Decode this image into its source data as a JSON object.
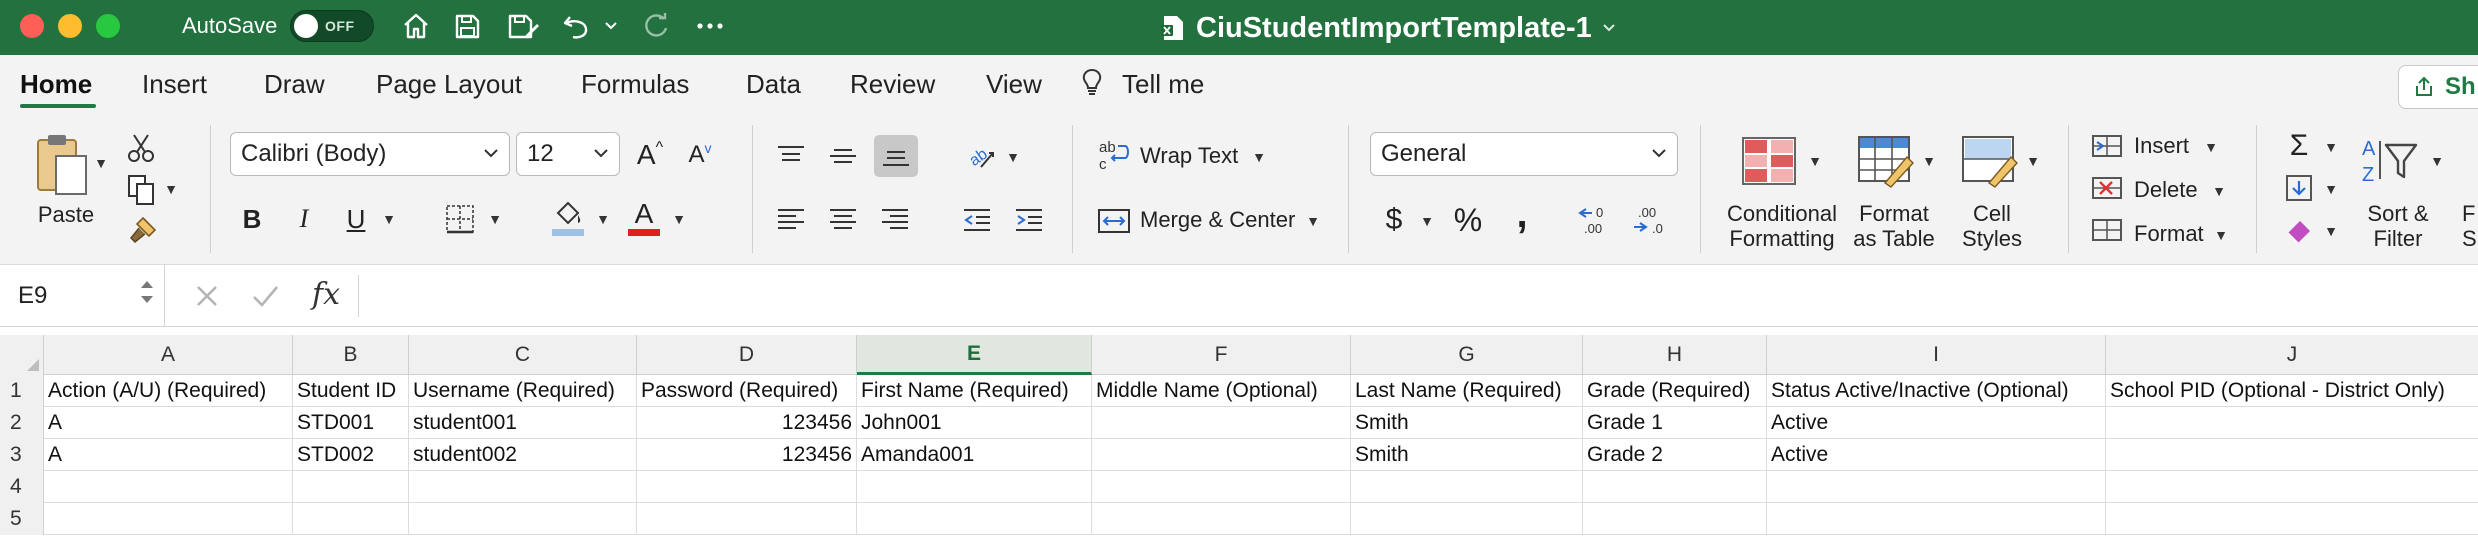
{
  "titlebar": {
    "autosave_label": "AutoSave",
    "autosave_state": "OFF",
    "document_title": "CiuStudentImportTemplate-1",
    "icons": [
      "home-icon",
      "save-icon",
      "save-as-icon",
      "undo-icon",
      "redo-icon",
      "more-icon"
    ]
  },
  "tabs": [
    {
      "label": "Home",
      "active": true
    },
    {
      "label": "Insert"
    },
    {
      "label": "Draw"
    },
    {
      "label": "Page Layout"
    },
    {
      "label": "Formulas"
    },
    {
      "label": "Data"
    },
    {
      "label": "Review"
    },
    {
      "label": "View"
    },
    {
      "label": "Tell me"
    }
  ],
  "share_label": "Sh",
  "ribbon": {
    "paste_label": "Paste",
    "font_name": "Calibri (Body)",
    "font_size": "12",
    "bold": "B",
    "italic": "I",
    "underline": "U",
    "wrap_text": "Wrap Text",
    "merge_center": "Merge & Center",
    "number_format": "General",
    "currency": "$",
    "percent": "%",
    "comma": ",",
    "conditional_formatting": [
      "Conditional",
      "Formatting"
    ],
    "format_as_table": [
      "Format",
      "as Table"
    ],
    "cell_styles": [
      "Cell",
      "Styles"
    ],
    "insert_label": "Insert",
    "delete_label": "Delete",
    "format_label": "Format",
    "sort_filter": [
      "Sort &",
      "Filter"
    ],
    "find_select": [
      "F",
      "S"
    ]
  },
  "formula_bar": {
    "name_box": "E9",
    "fx": "fx",
    "formula": ""
  },
  "grid": {
    "selected_column": "E",
    "columns": [
      "A",
      "B",
      "C",
      "D",
      "E",
      "F",
      "G",
      "H",
      "I",
      "J"
    ],
    "rows": [
      {
        "num": "1",
        "cells": [
          "Action (A/U) (Required)",
          "Student ID",
          "Username (Required)",
          "Password (Required)",
          "First Name (Required)",
          "Middle Name (Optional)",
          "Last Name (Required)",
          "Grade (Required)",
          "Status Active/Inactive (Optional)",
          "School PID (Optional - District Only)"
        ]
      },
      {
        "num": "2",
        "cells": [
          "A",
          "STD001",
          "student001",
          "123456",
          "John001",
          "",
          "Smith",
          "Grade 1",
          "Active",
          ""
        ]
      },
      {
        "num": "3",
        "cells": [
          "A",
          "STD002",
          "student002",
          "123456",
          "Amanda001",
          "",
          "Smith",
          "Grade 2",
          "Active",
          ""
        ]
      },
      {
        "num": "4",
        "cells": [
          "",
          "",
          "",
          "",
          "",
          "",
          "",
          "",
          "",
          ""
        ]
      },
      {
        "num": "5",
        "cells": [
          "",
          "",
          "",
          "",
          "",
          "",
          "",
          "",
          "",
          ""
        ]
      }
    ]
  },
  "colors": {
    "title_bar": "#22713f",
    "accent": "#1f7a43",
    "font_color_bar": "#e02020",
    "highlight_bar": "#9ec2e6"
  }
}
